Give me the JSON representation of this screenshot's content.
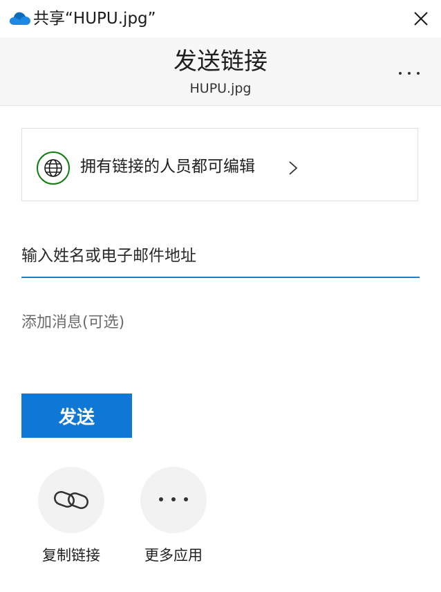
{
  "window": {
    "title": "共享“HUPU.jpg”",
    "app_icon": "onedrive-cloud-icon",
    "close_icon": "close-icon"
  },
  "header": {
    "title": "发送链接",
    "subtitle": "HUPU.jpg",
    "menu_icon": "more-options-icon"
  },
  "permission": {
    "label": "拥有链接的人员都可编辑",
    "icon": "globe-icon",
    "chevron": "chevron-right-icon",
    "accent_color": "#107c10"
  },
  "recipient": {
    "placeholder": "输入姓名或电子邮件地址",
    "value": ""
  },
  "message": {
    "placeholder": "添加消息(可选)",
    "value": ""
  },
  "send_button": {
    "label": "发送",
    "color": "#0f78d4"
  },
  "actions": [
    {
      "label": "复制链接",
      "icon": "link-icon"
    },
    {
      "label": "更多应用",
      "icon": "more-apps-icon"
    }
  ],
  "colors": {
    "accent": "#0f78d4",
    "input_underline": "#1f7ac9",
    "header_bg": "#f7f7f7"
  }
}
